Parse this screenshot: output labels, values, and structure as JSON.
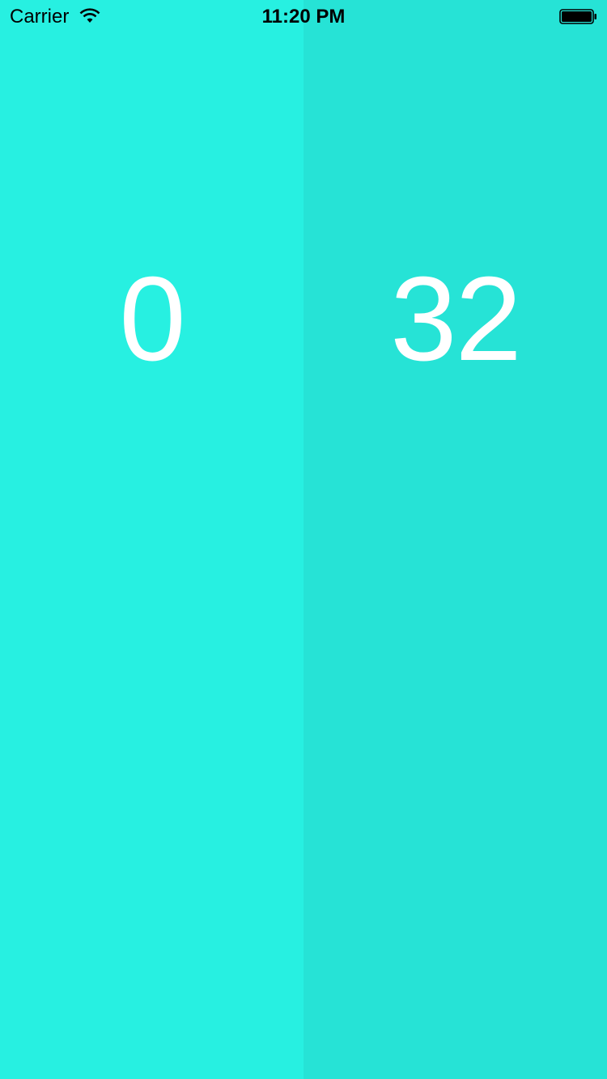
{
  "status_bar": {
    "carrier": "Carrier",
    "time": "11:20 PM",
    "wifi_icon": "wifi-icon",
    "battery_icon": "battery-icon",
    "battery_level": 1.0
  },
  "scoreboard": {
    "left": {
      "score": "0",
      "color": "#27f0e1"
    },
    "right": {
      "score": "32",
      "color": "#26e3d6"
    }
  }
}
